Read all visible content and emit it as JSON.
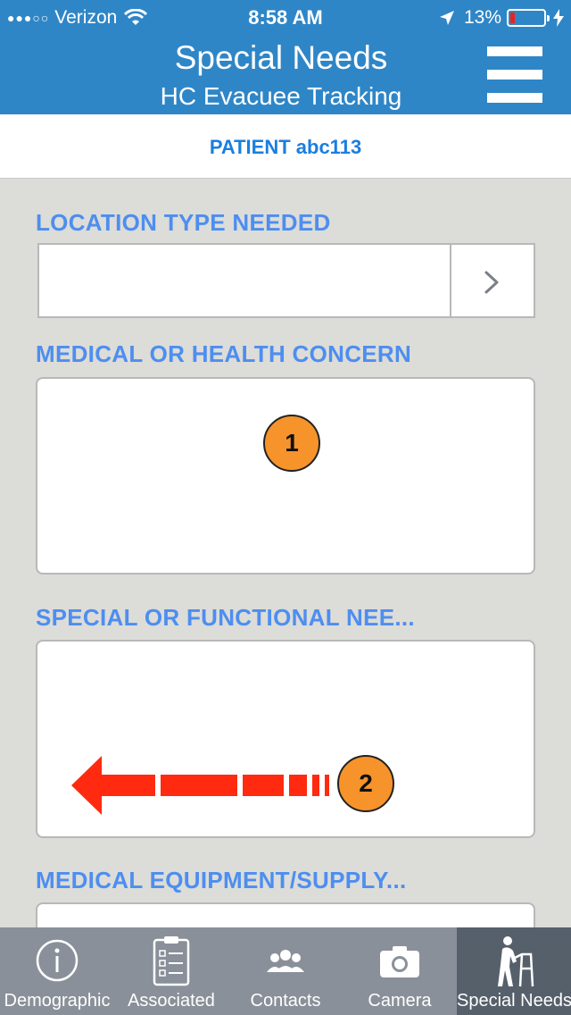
{
  "status_bar": {
    "carrier": "Verizon",
    "time": "8:58 AM",
    "battery": "13%"
  },
  "header": {
    "title": "Special Needs",
    "subtitle": "HC Evacuee Tracking"
  },
  "patient": {
    "label": "PATIENT abc113"
  },
  "form": {
    "location_label": "LOCATION TYPE NEEDED",
    "location_value": "",
    "medical_label": "MEDICAL OR HEALTH CONCERN",
    "medical_value": "",
    "special_label": "SPECIAL OR FUNCTIONAL NEE...",
    "special_value": "",
    "equipment_label": "MEDICAL EQUIPMENT/SUPPLY..."
  },
  "annotations": {
    "badge1": "1",
    "badge2": "2"
  },
  "tabs": [
    {
      "label": "Demographic",
      "icon": "info-icon"
    },
    {
      "label": "Associated",
      "icon": "clipboard-icon"
    },
    {
      "label": "Contacts",
      "icon": "people-icon"
    },
    {
      "label": "Camera",
      "icon": "camera-icon"
    },
    {
      "label": "Special Needs",
      "icon": "walker-person-icon"
    }
  ],
  "colors": {
    "header_bg": "#2f86c7",
    "label_blue": "#4d8ef0",
    "badge_orange": "#f7932b",
    "arrow_red": "#ff2a10",
    "tab_active": "#56606b"
  }
}
